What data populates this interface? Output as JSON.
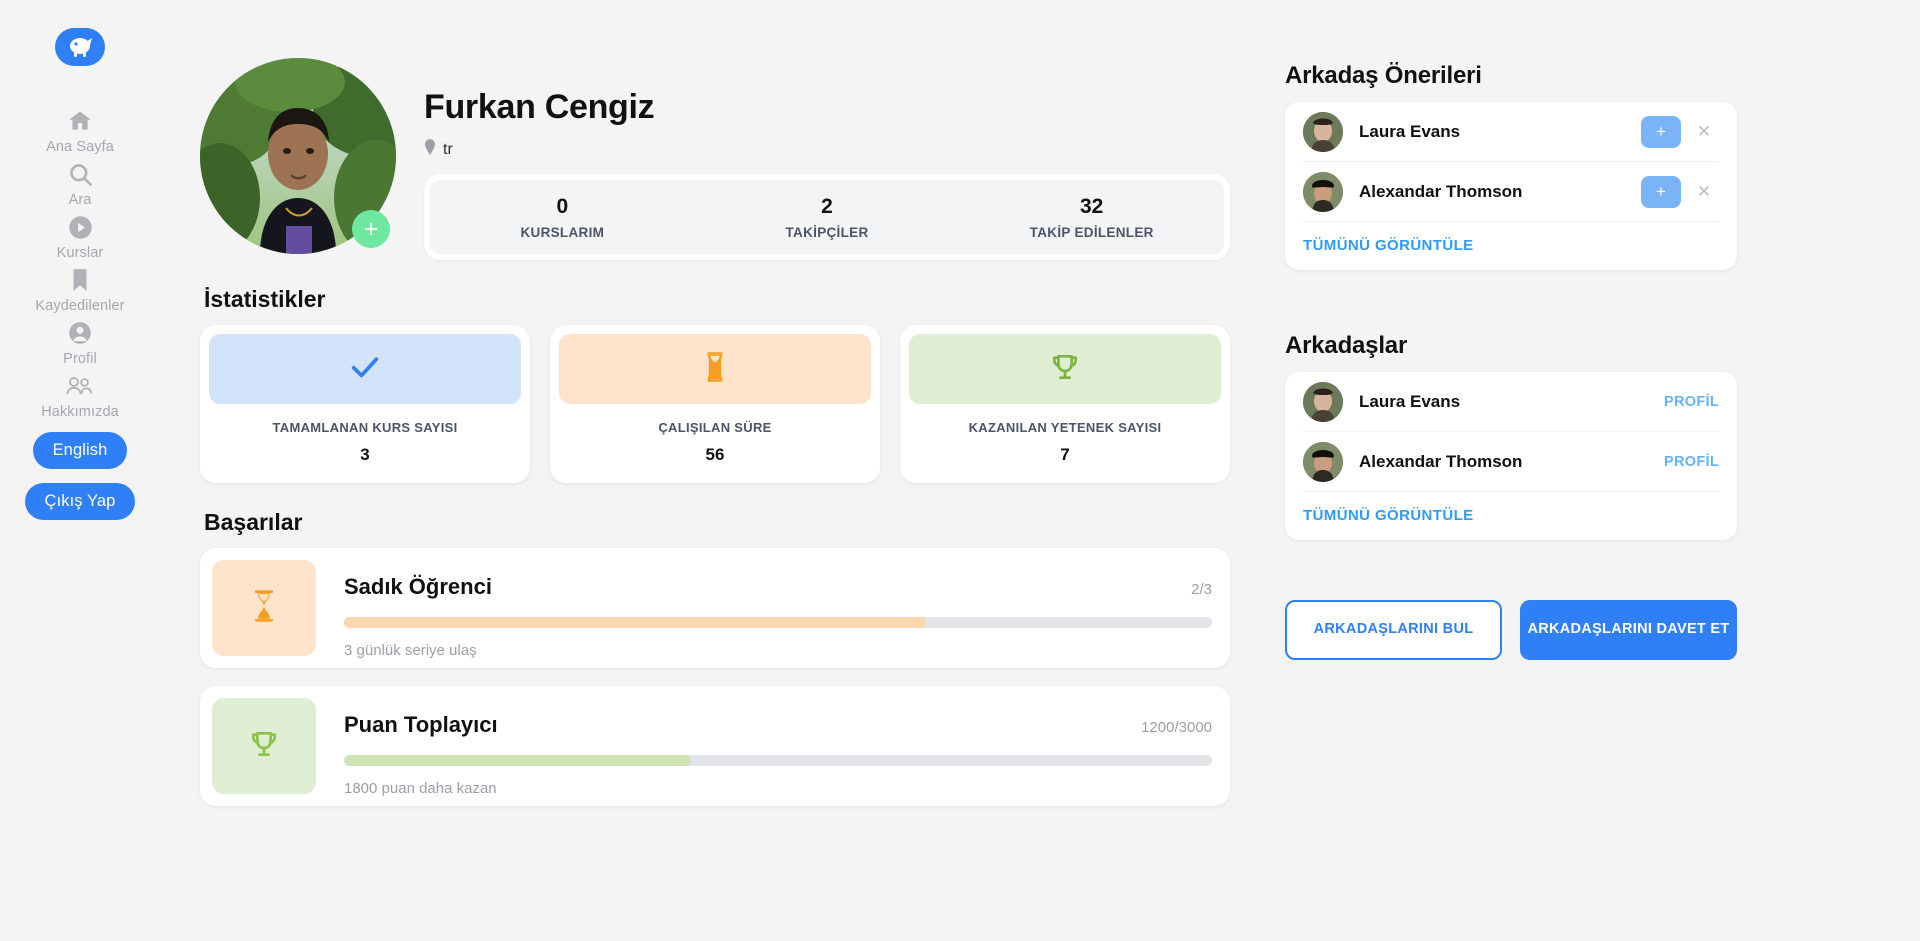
{
  "sidebar": {
    "logo_icon": "app-logo-icon",
    "items": [
      {
        "label": "Ana Sayfa",
        "icon": "home-icon"
      },
      {
        "label": "Ara",
        "icon": "search-icon"
      },
      {
        "label": "Kurslar",
        "icon": "play-circle-icon"
      },
      {
        "label": "Kaydedilenler",
        "icon": "bookmark-icon"
      },
      {
        "label": "Profil",
        "icon": "person-icon"
      },
      {
        "label": "Hakkımızda",
        "icon": "people-icon"
      }
    ],
    "language_button": "English",
    "logout_button": "Çıkış Yap"
  },
  "profile": {
    "name": "Furkan Cengiz",
    "location": "tr",
    "location_icon": "location-pin-icon",
    "add_photo_icon": "plus-icon",
    "counters": [
      {
        "value": "0",
        "label": "KURSLARIM"
      },
      {
        "value": "2",
        "label": "TAKİPÇİLER"
      },
      {
        "value": "32",
        "label": "TAKİP EDİLENLER"
      }
    ]
  },
  "statistics": {
    "title": "İstatistikler",
    "cards": [
      {
        "label": "TAMAMLANAN KURS SAYISI",
        "value": "3",
        "icon": "check-icon",
        "bg": "#d2e3fa",
        "fg": "#2f80f7"
      },
      {
        "label": "ÇALIŞILAN SÜRE",
        "value": "56",
        "icon": "hourglass-icon",
        "bg": "#fce3c9",
        "fg": "#f59e22"
      },
      {
        "label": "KAZANILAN YETENEK SAYISI",
        "value": "7",
        "icon": "trophy-icon",
        "bg": "#dfedd2",
        "fg": "#7cb342"
      }
    ]
  },
  "achievements": {
    "title": "Başarılar",
    "items": [
      {
        "title": "Sadık Öğrenci",
        "count": "2/3",
        "description": "3 günlük seriye ulaş",
        "icon": "hourglass-icon",
        "bg": "#fce3c9",
        "fg": "#f59e22",
        "fill": "#fbd7b0",
        "percent": 67
      },
      {
        "title": "Puan Toplayıcı",
        "count": "1200/3000",
        "description": "1800 puan daha kazan",
        "icon": "trophy-icon",
        "bg": "#dfedd2",
        "fg": "#8bc34a",
        "fill": "#cfe3b5",
        "percent": 40
      }
    ]
  },
  "suggestions": {
    "title": "Arkadaş Önerileri",
    "items": [
      {
        "name": "Laura Evans",
        "add_icon": "plus-icon",
        "dismiss_icon": "close-icon"
      },
      {
        "name": "Alexandar Thomson",
        "add_icon": "plus-icon",
        "dismiss_icon": "close-icon"
      }
    ],
    "view_all": "TÜMÜNÜ GÖRÜNTÜLE"
  },
  "friends": {
    "title": "Arkadaşlar",
    "items": [
      {
        "name": "Laura Evans",
        "action": "PROFİL"
      },
      {
        "name": "Alexandar Thomson",
        "action": "PROFİL"
      }
    ],
    "view_all": "TÜMÜNÜ GÖRÜNTÜLE"
  },
  "cta": {
    "find_friends": "ARKADAŞLARINI BUL",
    "invite_friends": "ARKADAŞLARINI DAVET ET"
  },
  "colors": {
    "brand_blue": "#2f80f7",
    "link_blue": "#2f9bf5",
    "page_bg": "#f4f4f5"
  }
}
